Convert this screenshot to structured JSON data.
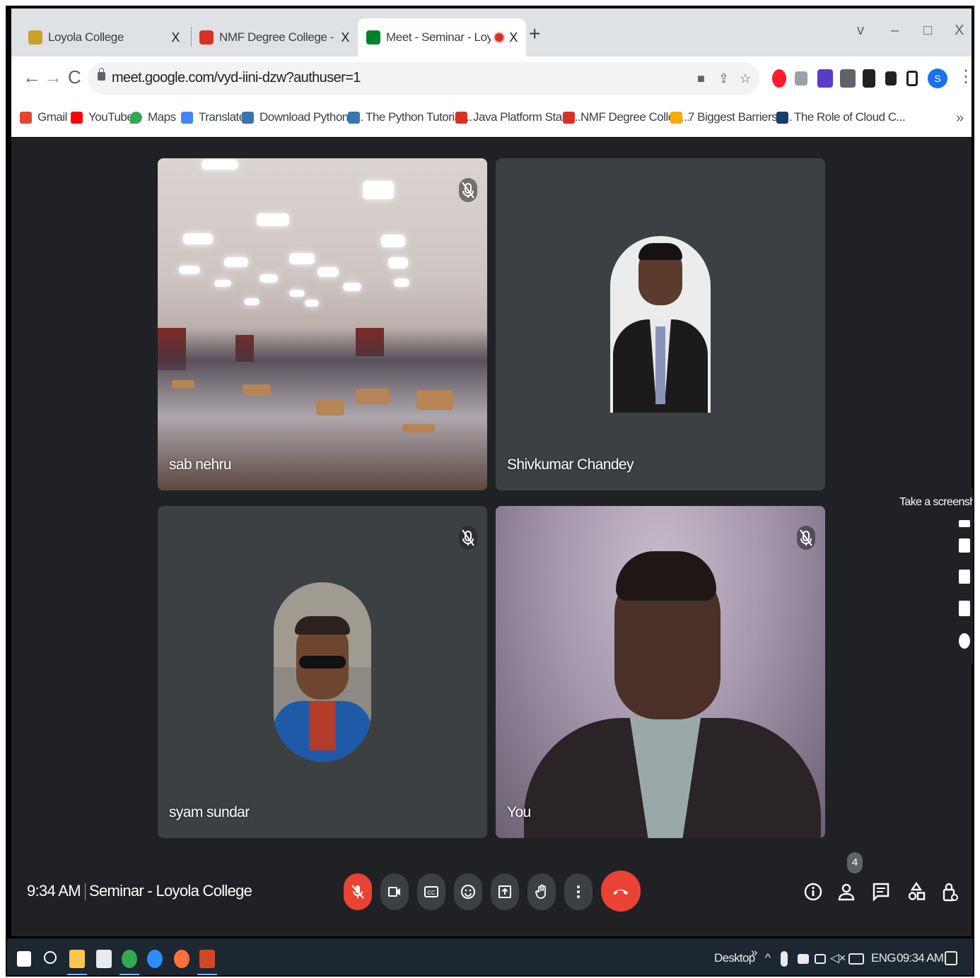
{
  "browser": {
    "tabs": [
      {
        "title": "Loyola College",
        "close": "X",
        "favicon_color": "#c9a227"
      },
      {
        "title": "NMF Degree College - Nirmala M",
        "close": "X",
        "favicon_color": "#d93025"
      },
      {
        "title": "Meet - Seminar - Loyola Col",
        "close": "X",
        "favicon_color": "#00832d",
        "recording_dot": "#d93025"
      }
    ],
    "new_tab": "+",
    "window_controls": {
      "chevron": "v",
      "minimize": "–",
      "restore": "□",
      "close": "X"
    },
    "nav": {
      "back": "←",
      "forward": "→",
      "reload": "C"
    },
    "url": "meet.google.com/vyd-iini-dzw?authuser=1",
    "profile_initial": "S",
    "menu": "⋮",
    "bookmarks": [
      {
        "label": "Gmail",
        "color": "#ea4335"
      },
      {
        "label": "YouTube",
        "color": "#ff0000"
      },
      {
        "label": "Maps",
        "color": "#34a853"
      },
      {
        "label": "Translate",
        "color": "#4285f4"
      },
      {
        "label": "Download Python |...",
        "color": "#3776ab"
      },
      {
        "label": "The Python Tutorial...",
        "color": "#3776ab"
      },
      {
        "label": "Java Platform Stand...",
        "color": "#d93025"
      },
      {
        "label": "NMF Degree Colleg...",
        "color": "#d93025"
      },
      {
        "label": "7 Biggest Barriers t...",
        "color": "#f9ab00"
      },
      {
        "label": "The Role of Cloud C...",
        "color": "#1a3d6b"
      }
    ],
    "bookmarks_more": "»"
  },
  "meet": {
    "participants": [
      {
        "name": "sab nehru",
        "muted": true
      },
      {
        "name": "Shivkumar Chandey",
        "muted": false
      },
      {
        "name": "syam sundar",
        "muted": true
      },
      {
        "name": "You",
        "muted": true
      }
    ],
    "time": "9:34 AM",
    "meeting_title": "Seminar - Loyola College",
    "people_count": "4",
    "screenshot_tooltip": "Take a screenshot"
  },
  "taskbar": {
    "desktop_label": "Desktop",
    "chevron": "»",
    "caret": "^",
    "language": "ENG",
    "clock": "09:34 AM"
  }
}
